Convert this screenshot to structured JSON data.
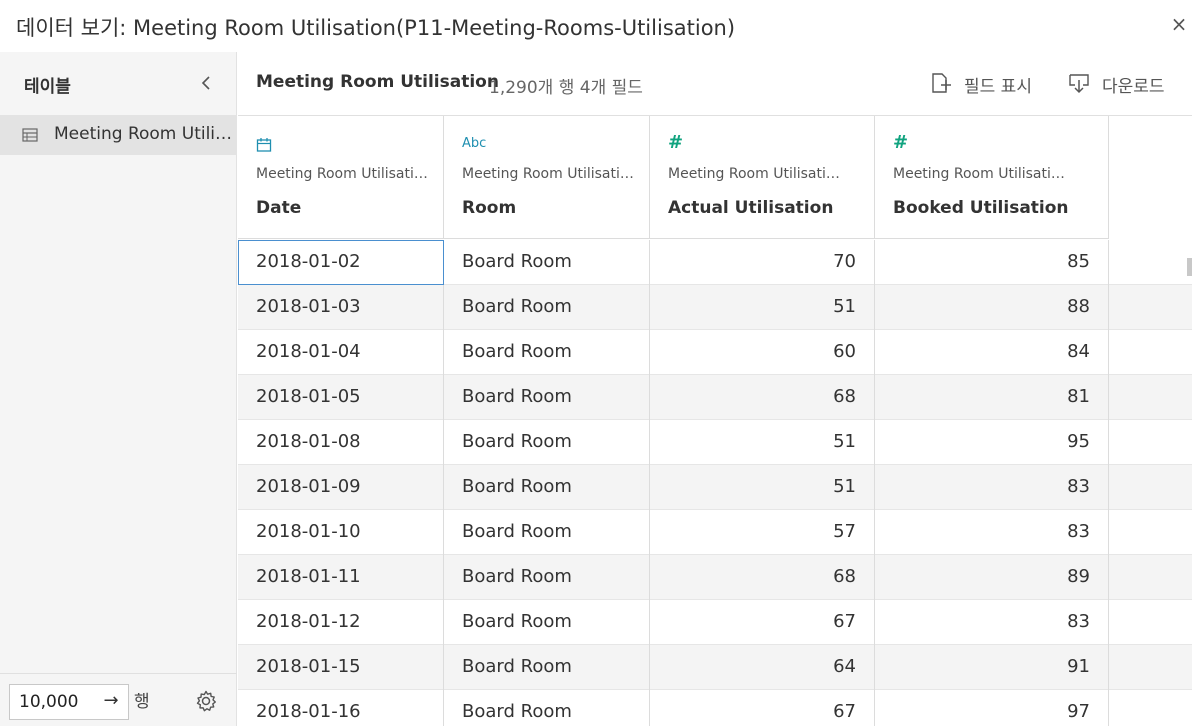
{
  "window": {
    "title": "데이터 보기: Meeting Room Utilisation(P11-Meeting-Rooms-Utilisation)",
    "close_label": "×"
  },
  "sidebar": {
    "title": "테이블",
    "tables": [
      {
        "label": "Meeting Room Utilisation"
      }
    ],
    "rows_limit": "10,000",
    "rows_unit": "행",
    "go_label": "→"
  },
  "toolbar": {
    "table_name": "Meeting Room Utilisation",
    "summary": "1,290개 행 4개 필드",
    "show_fields_label": "필드 표시",
    "download_label": "다운로드"
  },
  "columns": [
    {
      "type_label": "",
      "type_icon": "calendar-icon",
      "source": "Meeting Room Utilisation",
      "name": "Date"
    },
    {
      "type_label": "Abc",
      "type_icon": "string-type-icon",
      "source": "Meeting Room Utilisation",
      "name": "Room"
    },
    {
      "type_label": "#",
      "type_icon": "number-type-icon",
      "source": "Meeting Room Utilisation",
      "name": "Actual Utilisation"
    },
    {
      "type_label": "#",
      "type_icon": "number-type-icon",
      "source": "Meeting Room Utilisation",
      "name": "Booked Utilisation"
    }
  ],
  "rows": [
    {
      "date": "2018-01-02",
      "room": "Board Room",
      "actual": "70",
      "booked": "85"
    },
    {
      "date": "2018-01-03",
      "room": "Board Room",
      "actual": "51",
      "booked": "88"
    },
    {
      "date": "2018-01-04",
      "room": "Board Room",
      "actual": "60",
      "booked": "84"
    },
    {
      "date": "2018-01-05",
      "room": "Board Room",
      "actual": "68",
      "booked": "81"
    },
    {
      "date": "2018-01-08",
      "room": "Board Room",
      "actual": "51",
      "booked": "95"
    },
    {
      "date": "2018-01-09",
      "room": "Board Room",
      "actual": "51",
      "booked": "83"
    },
    {
      "date": "2018-01-10",
      "room": "Board Room",
      "actual": "57",
      "booked": "83"
    },
    {
      "date": "2018-01-11",
      "room": "Board Room",
      "actual": "68",
      "booked": "89"
    },
    {
      "date": "2018-01-12",
      "room": "Board Room",
      "actual": "67",
      "booked": "83"
    },
    {
      "date": "2018-01-15",
      "room": "Board Room",
      "actual": "64",
      "booked": "91"
    },
    {
      "date": "2018-01-16",
      "room": "Board Room",
      "actual": "67",
      "booked": "97"
    }
  ]
}
